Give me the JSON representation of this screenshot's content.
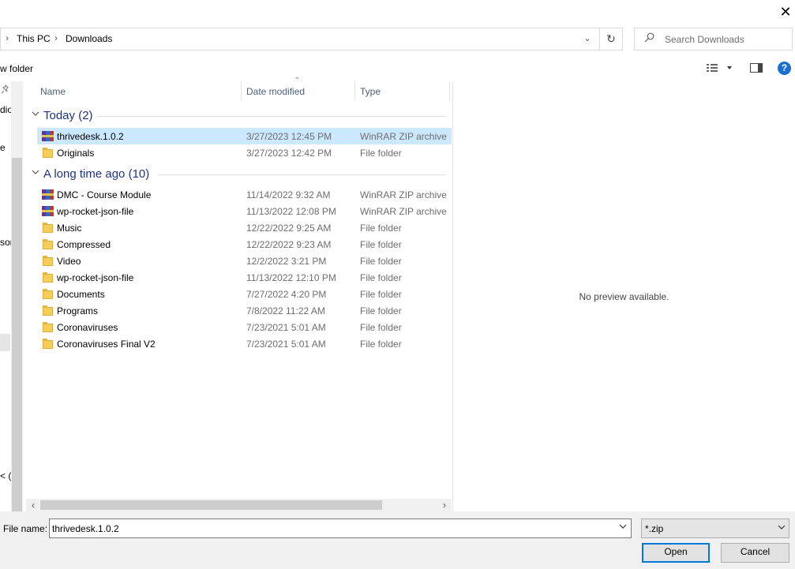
{
  "window": {
    "close_glyph": "✕"
  },
  "address": {
    "crumbs": [
      "This PC",
      "Downloads"
    ],
    "chevron": "›",
    "dropdown_glyph": "⌄",
    "refresh_glyph": "↻"
  },
  "search": {
    "placeholder": "Search Downloads",
    "icon": "search-icon"
  },
  "toolbar": {
    "new_folder_label": "w folder",
    "help_glyph": "?"
  },
  "nav_fragments": [
    {
      "text": "dio"
    },
    {
      "text": "e"
    },
    {
      "text": "sor"
    },
    {
      "text": "< (H"
    }
  ],
  "columns": {
    "name": "Name",
    "date_modified": "Date modified",
    "type": "Type",
    "sort_glyph": "⌃"
  },
  "groups": [
    {
      "title": "Today (2)",
      "items": [
        {
          "name": "thrivedesk.1.0.2",
          "date": "3/27/2023 12:45 PM",
          "type": "WinRAR ZIP archive",
          "kind": "archive",
          "selected": true
        },
        {
          "name": "Originals",
          "date": "3/27/2023 12:42 PM",
          "type": "File folder",
          "kind": "folder"
        }
      ]
    },
    {
      "title": "A long time ago (10)",
      "items": [
        {
          "name": "DMC - Course Module",
          "date": "11/14/2022 9:32 AM",
          "type": "WinRAR ZIP archive",
          "kind": "archive"
        },
        {
          "name": "wp-rocket-json-file",
          "date": "11/13/2022 12:08 PM",
          "type": "WinRAR ZIP archive",
          "kind": "archive"
        },
        {
          "name": "Music",
          "date": "12/22/2022 9:25 AM",
          "type": "File folder",
          "kind": "folder"
        },
        {
          "name": "Compressed",
          "date": "12/22/2022 9:23 AM",
          "type": "File folder",
          "kind": "folder"
        },
        {
          "name": "Video",
          "date": "12/2/2022 3:21 PM",
          "type": "File folder",
          "kind": "folder"
        },
        {
          "name": "wp-rocket-json-file",
          "date": "11/13/2022 12:10 PM",
          "type": "File folder",
          "kind": "folder"
        },
        {
          "name": "Documents",
          "date": "7/27/2022 4:20 PM",
          "type": "File folder",
          "kind": "folder"
        },
        {
          "name": "Programs",
          "date": "7/8/2022 11:22 AM",
          "type": "File folder",
          "kind": "folder"
        },
        {
          "name": "Coronaviruses",
          "date": "7/23/2021 5:01 AM",
          "type": "File folder",
          "kind": "folder"
        },
        {
          "name": "Coronaviruses Final V2",
          "date": "7/23/2021 5:01 AM",
          "type": "File folder",
          "kind": "folder"
        }
      ]
    }
  ],
  "preview": {
    "text": "No preview available."
  },
  "bottom": {
    "file_name_label": "File name:",
    "file_name_value": "thrivedesk.1.0.2",
    "file_type_value": "*.zip",
    "open_label": "Open",
    "cancel_label": "Cancel"
  },
  "colors": {
    "selection": "#cce8ff",
    "group_header": "#1e3287",
    "primary_border": "#0078d7",
    "folder": "#f5cd5b"
  }
}
